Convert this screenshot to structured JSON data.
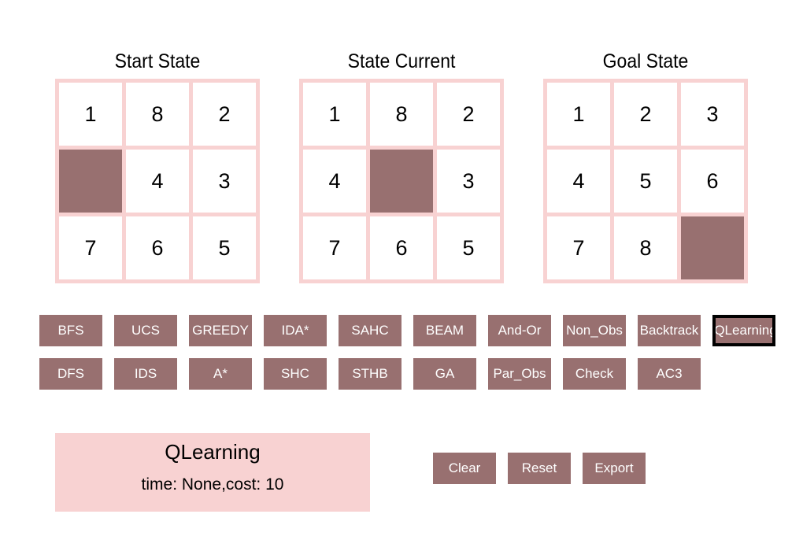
{
  "boards": {
    "start": {
      "title": "Start State",
      "cells": [
        "1",
        "8",
        "2",
        "",
        "4",
        "3",
        "7",
        "6",
        "5"
      ]
    },
    "current": {
      "title": "State Current",
      "cells": [
        "1",
        "8",
        "2",
        "4",
        "",
        "3",
        "7",
        "6",
        "5"
      ]
    },
    "goal": {
      "title": "Goal State",
      "cells": [
        "1",
        "2",
        "3",
        "4",
        "5",
        "6",
        "7",
        "8",
        ""
      ]
    }
  },
  "algorithms": {
    "row1": [
      "BFS",
      "UCS",
      "GREEDY",
      "IDA*",
      "SAHC",
      "BEAM",
      "And-Or",
      "Non_Obs",
      "Backtrack",
      "QLearning"
    ],
    "row2": [
      "DFS",
      "IDS",
      "A*",
      "SHC",
      "STHB",
      "GA",
      "Par_Obs",
      "Check",
      "AC3"
    ],
    "selected": "QLearning"
  },
  "status": {
    "algorithm": "QLearning",
    "info": "time: None,cost: 10"
  },
  "actions": {
    "clear": "Clear",
    "reset": "Reset",
    "export": "Export"
  },
  "colors": {
    "tile_blank": "#987070",
    "grid": "#f8d2d2",
    "button": "#987070",
    "button_text": "#ffffff"
  }
}
